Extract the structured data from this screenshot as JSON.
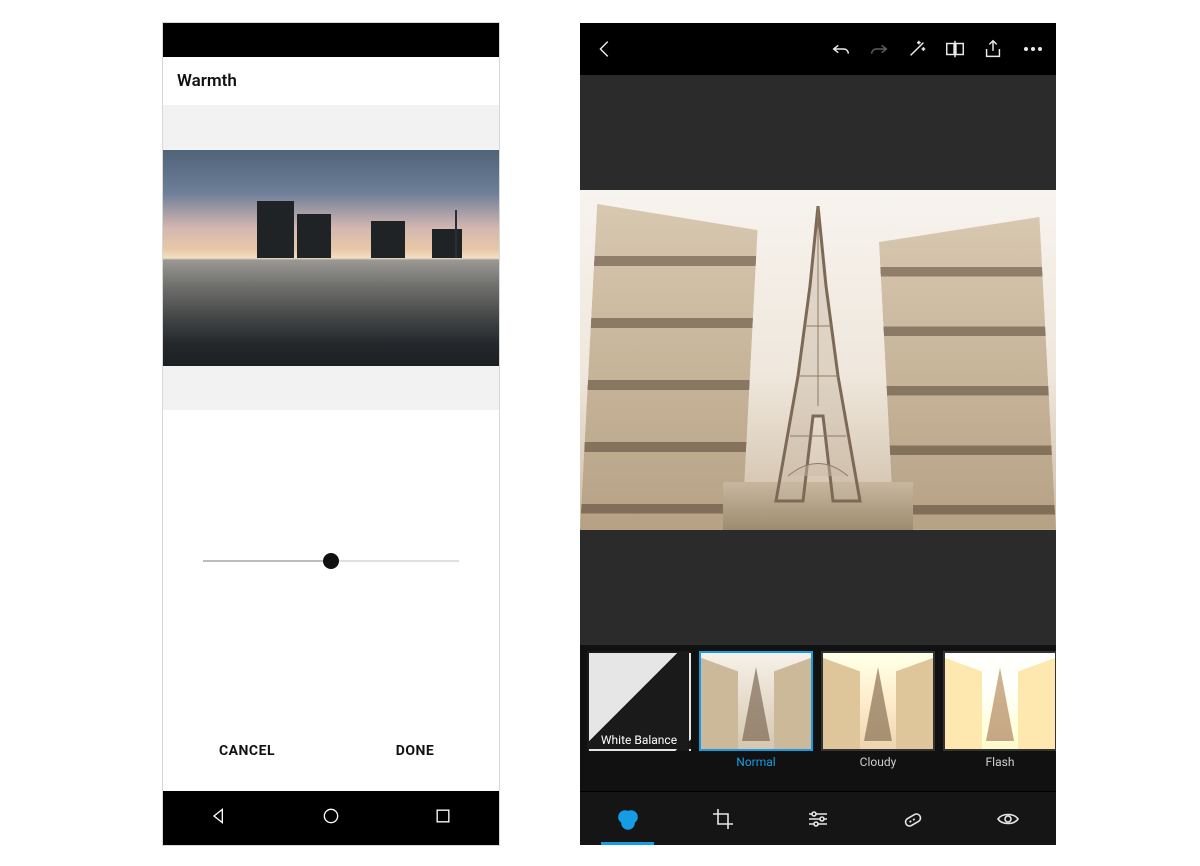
{
  "left": {
    "title": "Warmth",
    "slider_value": 50,
    "cancel": "CANCEL",
    "done": "DONE",
    "nav": {
      "back": "back-triangle",
      "home": "home-circle",
      "recent": "recent-square"
    }
  },
  "right": {
    "toolbar_icons": [
      "back",
      "undo",
      "redo",
      "magic",
      "compare",
      "share",
      "more"
    ],
    "filter_group": "White Balance",
    "filters": [
      {
        "name": "Normal",
        "selected": true,
        "variant": "normal"
      },
      {
        "name": "Cloudy",
        "selected": false,
        "variant": "warm"
      },
      {
        "name": "Flash",
        "selected": false,
        "variant": "bright"
      }
    ],
    "tools": [
      "filters",
      "crop",
      "adjust",
      "heal",
      "redeye"
    ],
    "active_tool": "filters",
    "accent": "#159ce4"
  }
}
